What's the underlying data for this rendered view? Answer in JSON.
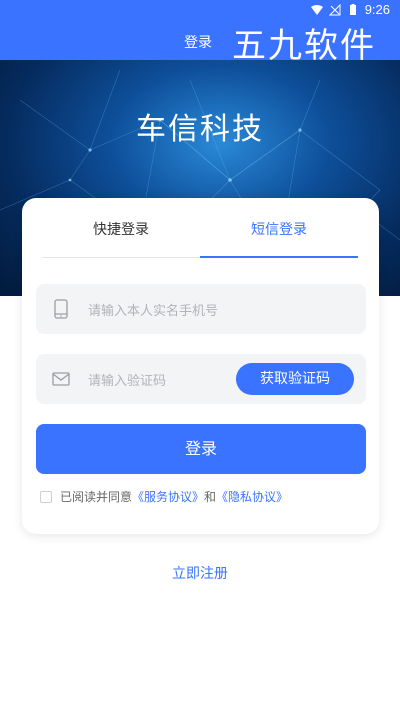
{
  "status_bar": {
    "time": "9:26",
    "icons": [
      "wifi-icon",
      "signal-icon",
      "battery-icon"
    ]
  },
  "app_bar": {
    "title": "登录",
    "watermark": "五九软件"
  },
  "hero": {
    "title": "车信科技"
  },
  "tabs": [
    {
      "label": "快捷登录",
      "active": false
    },
    {
      "label": "短信登录",
      "active": true
    }
  ],
  "phone_field": {
    "placeholder": "请输入本人实名手机号",
    "icon": "phone-icon"
  },
  "code_field": {
    "placeholder": "请输入验证码",
    "icon": "mail-icon",
    "button_label": "获取验证码"
  },
  "login_button": {
    "label": "登录"
  },
  "agreement": {
    "prefix": "已阅读并同意",
    "service_link": "《服务协议》",
    "conjunction": "和",
    "privacy_link": "《隐私协议》",
    "checked": false
  },
  "register_link": "立即注册",
  "colors": {
    "primary": "#3a73ff",
    "field_bg": "#f3f4f6",
    "hero_dark": "#021a3c"
  }
}
